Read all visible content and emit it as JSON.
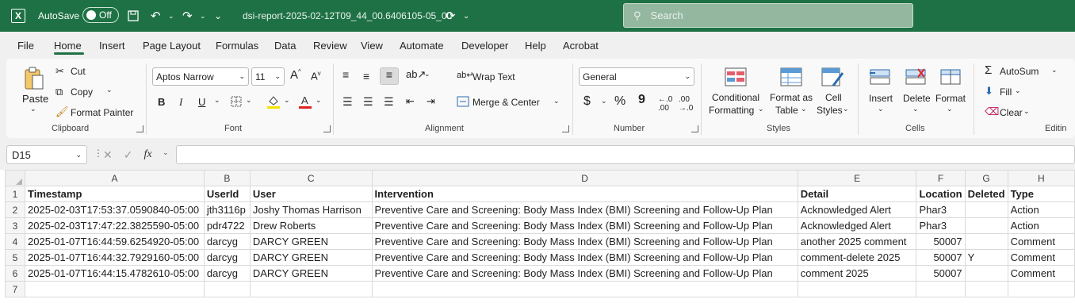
{
  "titlebar": {
    "autosave_label": "AutoSave",
    "autosave_state": "Off",
    "filename": "dsi-report-2025-02-12T09_44_00.6406105-05_00",
    "search_placeholder": "Search",
    "app_icon": "excel-icon"
  },
  "menu": {
    "items": [
      "File",
      "Home",
      "Insert",
      "Page Layout",
      "Formulas",
      "Data",
      "Review",
      "View",
      "Automate",
      "Developer",
      "Help",
      "Acrobat"
    ],
    "active": "Home"
  },
  "ribbon": {
    "clipboard": {
      "paste": "Paste",
      "cut": "Cut",
      "copy": "Copy",
      "format_painter": "Format Painter",
      "label": "Clipboard"
    },
    "font": {
      "font_name": "Aptos Narrow",
      "font_size": "11",
      "bold": "B",
      "italic": "I",
      "underline": "U",
      "label": "Font"
    },
    "alignment": {
      "wrap_text": "Wrap Text",
      "merge_center": "Merge & Center",
      "label": "Alignment"
    },
    "number": {
      "format": "General",
      "currency": "$",
      "percent": "%",
      "comma": "9",
      "label": "Number"
    },
    "styles": {
      "conditional": "Conditional",
      "formatting": "Formatting",
      "format_as": "Format as",
      "table": "Table",
      "cell": "Cell",
      "cell_styles": "Styles",
      "label": "Styles"
    },
    "cells": {
      "insert": "Insert",
      "delete": "Delete",
      "format": "Format",
      "label": "Cells"
    },
    "editing": {
      "autosum": "AutoSum",
      "fill": "Fill",
      "clear": "Clear",
      "label": "Editin"
    }
  },
  "formula_bar": {
    "name_box": "D15",
    "fx": "fx",
    "formula": ""
  },
  "sheet": {
    "columns": [
      "A",
      "B",
      "C",
      "D",
      "E",
      "F",
      "G",
      "H"
    ],
    "row_numbers": [
      "1",
      "2",
      "3",
      "4",
      "5",
      "6",
      "7"
    ],
    "rows": [
      [
        "Timestamp",
        "UserId",
        "User",
        "Intervention",
        "Detail",
        "Location",
        "Deleted",
        "Type"
      ],
      [
        "2025-02-03T17:53:37.0590840-05:00",
        "jth3116p",
        "Joshy Thomas Harrison",
        "Preventive Care and Screening: Body Mass Index (BMI) Screening and Follow-Up Plan",
        "Acknowledged Alert",
        "Phar3",
        "",
        "Action"
      ],
      [
        "2025-02-03T17:47:22.3825590-05:00",
        "pdr4722",
        "Drew Roberts",
        "Preventive Care and Screening: Body Mass Index (BMI) Screening and Follow-Up Plan",
        "Acknowledged Alert",
        "Phar3",
        "",
        "Action"
      ],
      [
        "2025-01-07T16:44:59.6254920-05:00",
        "darcyg",
        "DARCY GREEN",
        "Preventive Care and Screening: Body Mass Index (BMI) Screening and Follow-Up Plan",
        "another 2025 comment",
        "50007",
        "",
        "Comment"
      ],
      [
        "2025-01-07T16:44:32.7929160-05:00",
        "darcyg",
        "DARCY GREEN",
        "Preventive Care and Screening: Body Mass Index (BMI) Screening and Follow-Up Plan",
        "comment-delete 2025",
        "50007",
        "Y",
        "Comment"
      ],
      [
        "2025-01-07T16:44:15.4782610-05:00",
        "darcyg",
        "DARCY GREEN",
        "Preventive Care and Screening: Body Mass Index (BMI) Screening and Follow-Up Plan",
        "comment 2025",
        "50007",
        "",
        "Comment"
      ],
      [
        "",
        "",
        "",
        "",
        "",
        "",
        "",
        ""
      ]
    ]
  },
  "colors": {
    "brand": "#1e7145",
    "ribbon_bg": "#f0f0f0",
    "grid_line": "#dadada"
  }
}
